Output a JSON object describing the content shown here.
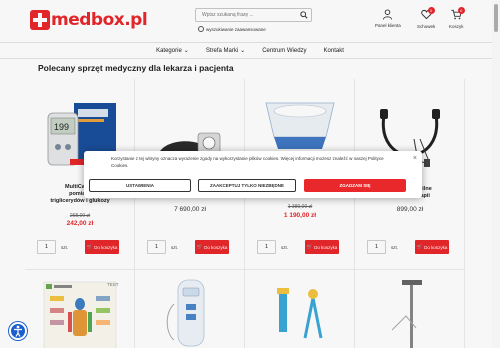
{
  "header": {
    "logo_text": "medbox.pl",
    "search_placeholder": "Wpisz szukaną frazę ...",
    "advanced_search": "wyszukiwanie zaawansowane",
    "account_label": "Panel klienta",
    "wishlist_label": "Schowek",
    "wishlist_count": "0",
    "cart_label": "Koszyk",
    "cart_count": "0"
  },
  "nav": {
    "items": [
      "Kategorie",
      "Strefa Marki",
      "Centrum Wiedzy",
      "Kontakt"
    ]
  },
  "page_title": "Polecany sprzęt medyczny dla lekarza i pacjenta",
  "products": [
    {
      "name_lines": [
        "MultiCareIn",
        "pomiaru",
        "triglicerydów i glukozy"
      ],
      "old_price": "268,00 zł",
      "price": "242,00 zł",
      "qty": "1",
      "unit": "szt.",
      "cart": "Do koszyka",
      "sale": true
    },
    {
      "name_lines": [],
      "old_price": "",
      "price": "7 690,00 zł",
      "qty": "1",
      "unit": "szt.",
      "cart": "Do koszyka",
      "sale": false
    },
    {
      "name_lines": [],
      "old_price": "1 380,00 zł",
      "price": "1 190,00 zł",
      "qty": "1",
      "unit": "szt.",
      "cart": "Do koszyka",
      "sale": true
    },
    {
      "name_lines": [
        "r mobilne",
        "jalotrapii"
      ],
      "old_price": "",
      "price": "899,00 zł",
      "qty": "1",
      "unit": "szt.",
      "cart": "Do koszyka",
      "sale": false
    }
  ],
  "second_row": {
    "brand_label": "TEST"
  },
  "cookie": {
    "text": "Korzystanie z tej witryny oznacza wyrażenie zgody na wykorzystanie plików cookies. Więcej informacji możesz znaleźć w naszej Polityce Cookies.",
    "settings": "USTAWIENIA",
    "necessary": "ZAAKCEPTUJ TYLKO NIEZBĘDNE",
    "accept": "ZGADZAM SIĘ",
    "close": "×"
  },
  "colors": {
    "accent": "#e8282b",
    "a11y": "#1b5fcf"
  }
}
